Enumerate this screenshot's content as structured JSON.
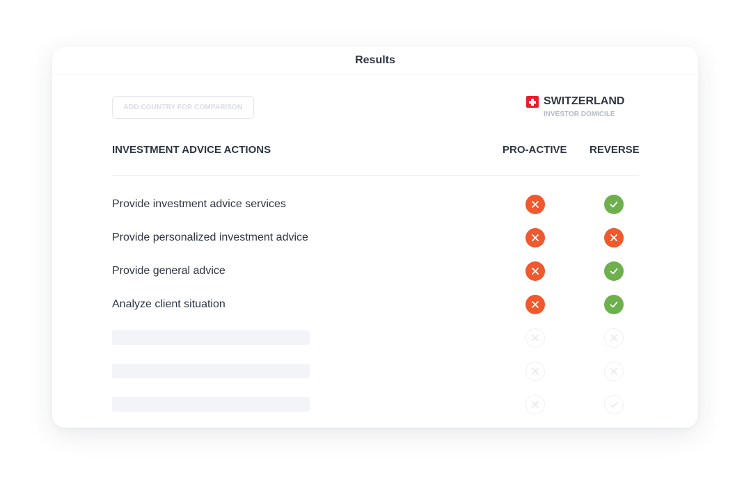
{
  "card": {
    "title": "Results"
  },
  "comparison": {
    "add_country_label": "ADD COUNTRY FOR COMPARISON"
  },
  "country": {
    "name": "SWITZERLAND",
    "subtitle": "INVESTOR DOMICILE",
    "flag_icon": "swiss-flag-icon"
  },
  "table": {
    "headers": {
      "actions": "INVESTMENT ADVICE ACTIONS",
      "pro_active": "PRO-ACTIVE",
      "reverse": "REVERSE"
    },
    "rows": [
      {
        "label": "Provide investment advice services",
        "pro_active": "no",
        "reverse": "yes"
      },
      {
        "label": "Provide personalized investment advice",
        "pro_active": "no",
        "reverse": "no"
      },
      {
        "label": "Provide general advice",
        "pro_active": "no",
        "reverse": "yes"
      },
      {
        "label": "Analyze client situation",
        "pro_active": "no",
        "reverse": "yes"
      }
    ],
    "placeholder_rows": [
      {
        "pro_active": "no",
        "reverse": "no"
      },
      {
        "pro_active": "no",
        "reverse": "no"
      },
      {
        "pro_active": "no",
        "reverse": "yes"
      }
    ]
  },
  "colors": {
    "no": "#f0582d",
    "yes": "#6db04d",
    "text": "#2f3542",
    "muted": "#b4bbc4"
  }
}
